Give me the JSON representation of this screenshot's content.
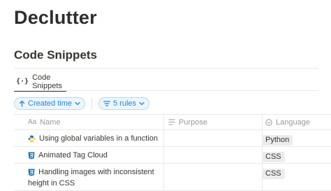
{
  "page": {
    "title": "Declutter"
  },
  "database": {
    "title": "Code Snippets",
    "views": [
      {
        "label": "Code Snippets",
        "icon": "code-brackets-icon"
      }
    ],
    "filters": {
      "sort_label": "Created time",
      "rules_label": "5 rules"
    },
    "columns": [
      {
        "label": "Name",
        "icon": "Aa"
      },
      {
        "label": "Purpose",
        "icon": "lines-icon"
      },
      {
        "label": "Language",
        "icon": "select-icon"
      }
    ],
    "rows": [
      {
        "name": "Using global variables in a function",
        "icon": "python-icon",
        "purpose": "",
        "language": "Python"
      },
      {
        "name": "Animated Tag Cloud",
        "icon": "css3-icon",
        "purpose": "",
        "language": "CSS"
      },
      {
        "name": "Handling images with inconsistent height in CSS",
        "icon": "css3-icon",
        "purpose": "",
        "language": "CSS"
      }
    ]
  },
  "colors": {
    "accent": "#2383e2",
    "css_icon": "#1572b6",
    "python_blue": "#3776ab",
    "python_yellow": "#ffd43b"
  }
}
